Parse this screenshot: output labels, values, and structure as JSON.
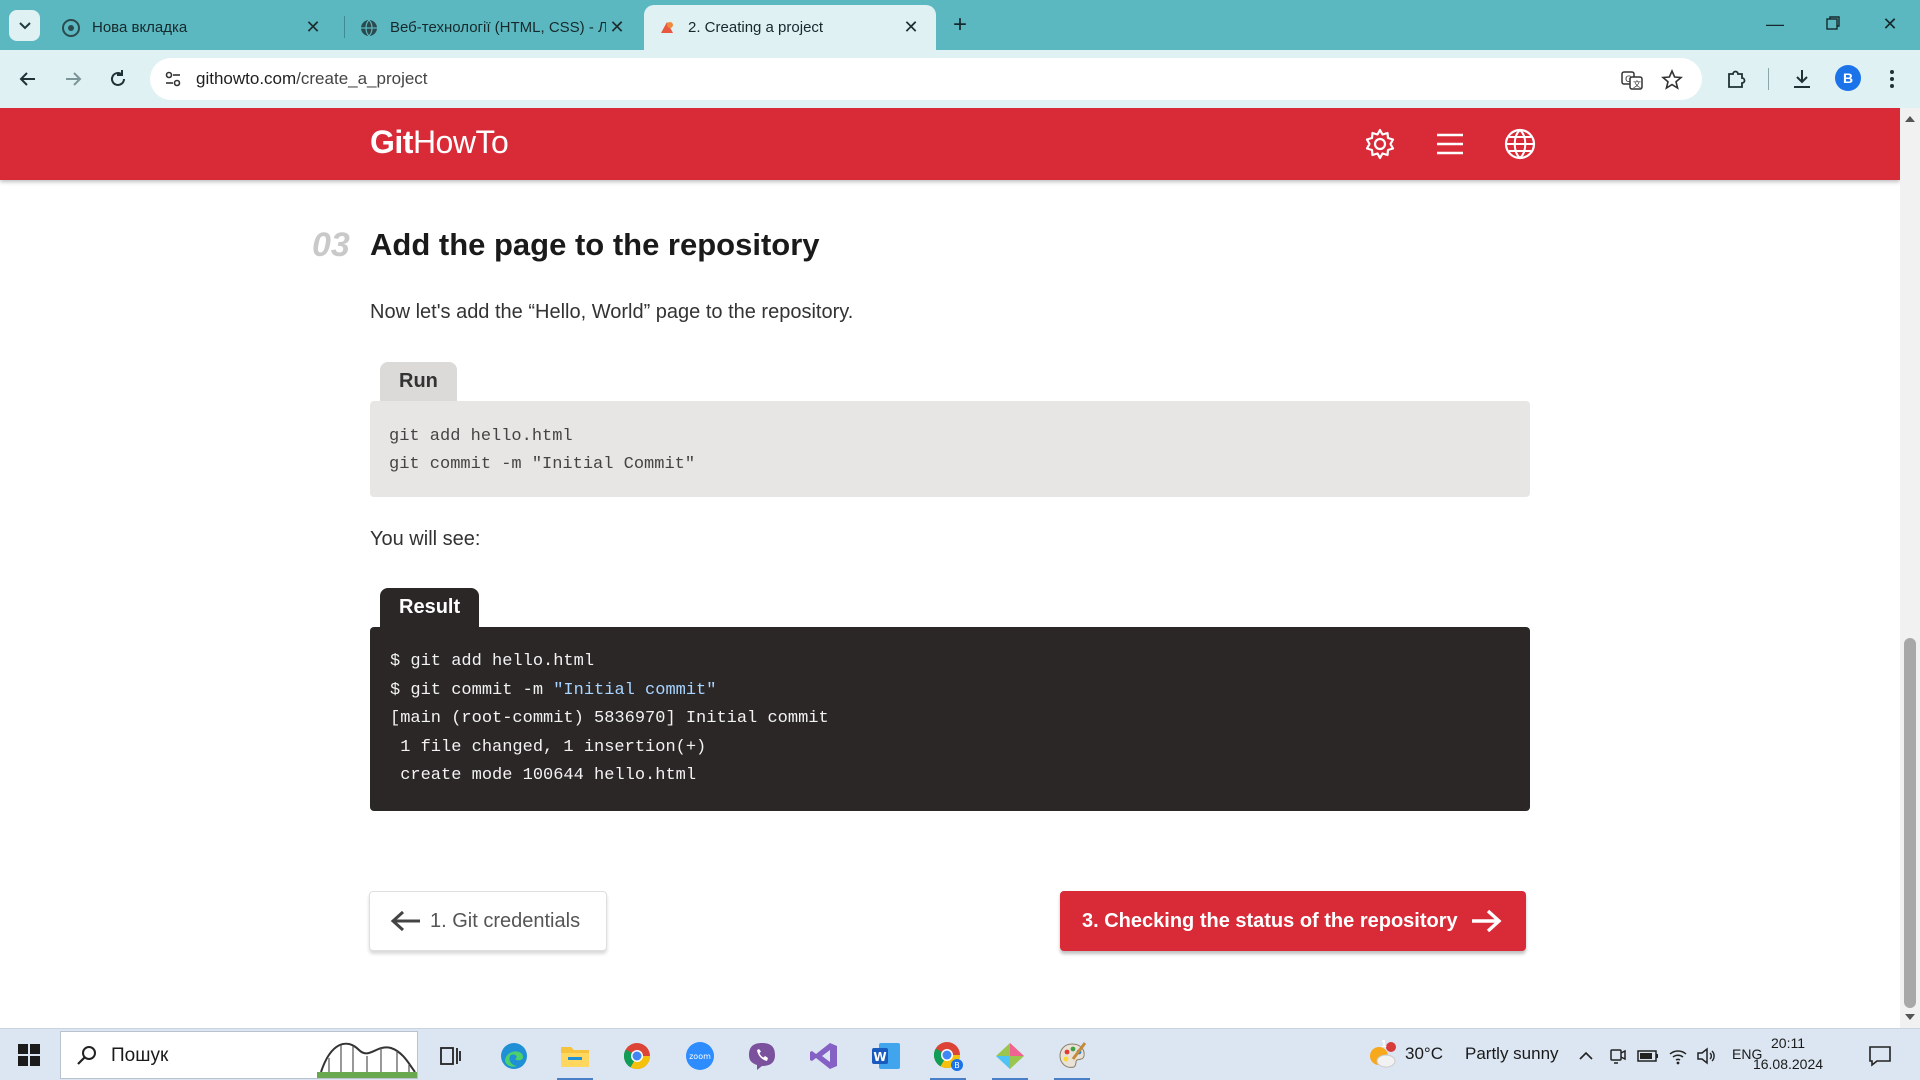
{
  "browser": {
    "tabs": [
      {
        "title": "Нова вкладка",
        "active": false
      },
      {
        "title": "Веб-технології (HTML, CSS) - Л",
        "active": false
      },
      {
        "title": "2. Creating a project",
        "active": true
      }
    ],
    "url_host": "githowto.com",
    "url_path": "/create_a_project",
    "profile_initial": "B"
  },
  "site": {
    "logo_bold": "Git",
    "logo_rest": "HowTo",
    "brand_color": "#d92a37"
  },
  "section": {
    "number": "03",
    "title": "Add the page to the repository",
    "intro": "Now let's add the “Hello, World” page to the repository.",
    "run_label": "Run",
    "run_code": "git add hello.html\ngit commit -m \"Initial Commit\"",
    "you_will_see": "You will see:",
    "result_label": "Result",
    "result_lines": [
      "$ git add hello.html",
      "$ git commit -m ",
      "\"Initial commit\"",
      "[main (root-commit) 5836970] Initial commit",
      " 1 file changed, 1 insertion(+)",
      " create mode 100644 hello.html"
    ]
  },
  "nav": {
    "prev_label": "1. Git credentials",
    "next_label": "3. Checking the status of the repository"
  },
  "taskbar": {
    "search_placeholder": "Пошук",
    "weather_temp": "30°C",
    "weather_desc": "Partly sunny",
    "weather_badge": "1",
    "language": "ENG",
    "time": "20:11",
    "date": "16.08.2024"
  }
}
